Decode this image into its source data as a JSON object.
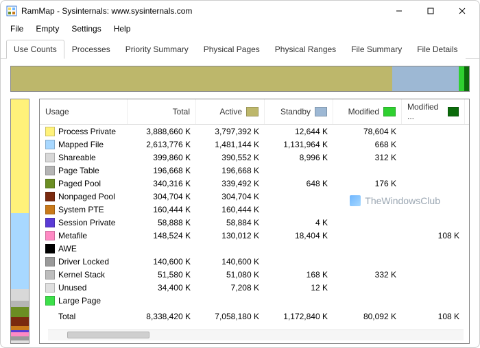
{
  "window": {
    "title": "RamMap - Sysinternals: www.sysinternals.com"
  },
  "menus": [
    "File",
    "Empty",
    "Settings",
    "Help"
  ],
  "tabs": [
    "Use Counts",
    "Processes",
    "Priority Summary",
    "Physical Pages",
    "Physical Ranges",
    "File Summary",
    "File Details"
  ],
  "active_tab": 0,
  "columns": {
    "usage": "Usage",
    "total": "Total",
    "active": "Active",
    "standby": "Standby",
    "modified": "Modified",
    "modified2": "Modified ..."
  },
  "swatches": {
    "active": "#bdb76b",
    "standby": "#9db8d4",
    "modified": "#2fd030",
    "modified2": "#0b6b0b"
  },
  "rows": [
    {
      "name": "Process Private",
      "color": "#fff27a",
      "total": "3,888,660 K",
      "active": "3,797,392 K",
      "standby": "12,644 K",
      "modified": "78,604 K",
      "modified2": ""
    },
    {
      "name": "Mapped File",
      "color": "#a8d8ff",
      "total": "2,613,776 K",
      "active": "1,481,144 K",
      "standby": "1,131,964 K",
      "modified": "668 K",
      "modified2": ""
    },
    {
      "name": "Shareable",
      "color": "#d8d8d8",
      "total": "399,860 K",
      "active": "390,552 K",
      "standby": "8,996 K",
      "modified": "312 K",
      "modified2": ""
    },
    {
      "name": "Page Table",
      "color": "#b5b5b5",
      "total": "196,668 K",
      "active": "196,668 K",
      "standby": "",
      "modified": "",
      "modified2": ""
    },
    {
      "name": "Paged Pool",
      "color": "#6b8e23",
      "total": "340,316 K",
      "active": "339,492 K",
      "standby": "648 K",
      "modified": "176 K",
      "modified2": ""
    },
    {
      "name": "Nonpaged Pool",
      "color": "#7a2a0f",
      "total": "304,704 K",
      "active": "304,704 K",
      "standby": "",
      "modified": "",
      "modified2": ""
    },
    {
      "name": "System PTE",
      "color": "#c97a1a",
      "total": "160,444 K",
      "active": "160,444 K",
      "standby": "",
      "modified": "",
      "modified2": ""
    },
    {
      "name": "Session Private",
      "color": "#5a3bd6",
      "total": "58,888 K",
      "active": "58,884 K",
      "standby": "4 K",
      "modified": "",
      "modified2": ""
    },
    {
      "name": "Metafile",
      "color": "#ff8ac4",
      "total": "148,524 K",
      "active": "130,012 K",
      "standby": "18,404 K",
      "modified": "",
      "modified2": "108 K"
    },
    {
      "name": "AWE",
      "color": "#000000",
      "total": "",
      "active": "",
      "standby": "",
      "modified": "",
      "modified2": ""
    },
    {
      "name": "Driver Locked",
      "color": "#9a9a9a",
      "total": "140,600 K",
      "active": "140,600 K",
      "standby": "",
      "modified": "",
      "modified2": ""
    },
    {
      "name": "Kernel Stack",
      "color": "#bdbdbd",
      "total": "51,580 K",
      "active": "51,080 K",
      "standby": "168 K",
      "modified": "332 K",
      "modified2": ""
    },
    {
      "name": "Unused",
      "color": "#e0e0e0",
      "total": "34,400 K",
      "active": "7,208 K",
      "standby": "12 K",
      "modified": "",
      "modified2": ""
    },
    {
      "name": "Large Page",
      "color": "#3de04a",
      "total": "",
      "active": "",
      "standby": "",
      "modified": "",
      "modified2": ""
    }
  ],
  "totals": {
    "label": "Total",
    "total": "8,338,420 K",
    "active": "7,058,180 K",
    "standby": "1,172,840 K",
    "modified": "80,092 K",
    "modified2": "108 K"
  },
  "topbar": [
    {
      "color": "#bdb76b",
      "pct": 83.2
    },
    {
      "color": "#9db8d4",
      "pct": 14.6
    },
    {
      "color": "#2fd030",
      "pct": 1.1
    },
    {
      "color": "#0b6b0b",
      "pct": 1.1
    }
  ],
  "sidebar": [
    {
      "color": "#fff27a",
      "pct": 46.6
    },
    {
      "color": "#a8d8ff",
      "pct": 31.3
    },
    {
      "color": "#d8d8d8",
      "pct": 4.8
    },
    {
      "color": "#b5b5b5",
      "pct": 2.4
    },
    {
      "color": "#6b8e23",
      "pct": 4.1
    },
    {
      "color": "#7a2a0f",
      "pct": 3.7
    },
    {
      "color": "#c97a1a",
      "pct": 1.9
    },
    {
      "color": "#5a3bd6",
      "pct": 0.7
    },
    {
      "color": "#ff8ac4",
      "pct": 1.8
    },
    {
      "color": "#9a9a9a",
      "pct": 1.7
    },
    {
      "color": "#e0e0e0",
      "pct": 1.0
    }
  ],
  "watermark": "TheWindowsClub"
}
